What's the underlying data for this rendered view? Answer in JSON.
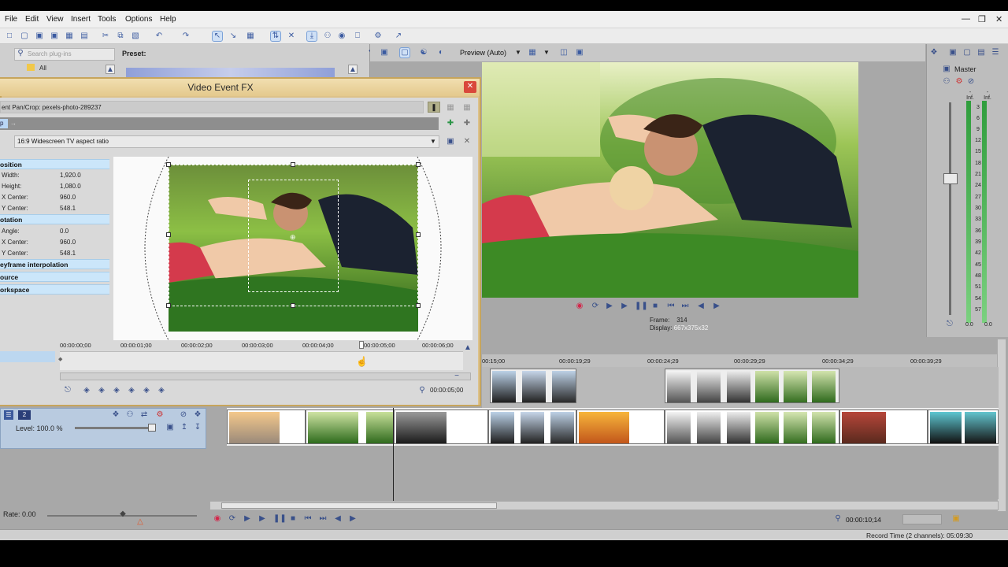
{
  "menu": [
    "File",
    "Edit",
    "View",
    "Insert",
    "Tools",
    "Options",
    "Help"
  ],
  "plugin_chooser": {
    "search_placeholder": "Search plug-ins",
    "preset_label": "Preset:",
    "tree_root": "All"
  },
  "preview": {
    "mode_label": "Preview (Auto)",
    "frame_label": "Frame:",
    "frame_value": "314",
    "display_label": "Display:",
    "display_value": "667x375x32"
  },
  "master": {
    "title": "Master",
    "meter_scale": [
      "-Inf.",
      "-Inf.",
      "3",
      "6",
      "9",
      "12",
      "15",
      "18",
      "21",
      "24",
      "27",
      "30",
      "33",
      "36",
      "39",
      "42",
      "45",
      "48",
      "51",
      "54",
      "57"
    ],
    "footer_left": "0.0",
    "footer_right": "0.0"
  },
  "fx_window": {
    "title": "Video Event FX",
    "plugin_chain": "ent Pan/Crop:  pexels-photo-289237",
    "aspect_option": "16:9 Widescreen TV aspect ratio",
    "chip": "p"
  },
  "properties": {
    "position_header": "osition",
    "width_label": "Width:",
    "width_value": "1,920.0",
    "height_label": "Height:",
    "height_value": "1,080.0",
    "xc_label": "X Center:",
    "xc_value": "960.0",
    "yc_label": "Y Center:",
    "yc_value": "548.1",
    "rotation_header": "otation",
    "angle_label": "Angle:",
    "angle_value": "0.0",
    "rxc_label": "X Center:",
    "rxc_value": "960.0",
    "ryc_label": "Y Center:",
    "ryc_value": "548.1",
    "kf_interp_header": "eyframe interpolation",
    "source_header": "ource",
    "workspace_header": "orkspace"
  },
  "keyframe_timeline": {
    "ticks": [
      "00:00:00;00",
      "00:00:01;00",
      "00:00:02;00",
      "00:00:03;00",
      "00:00:04;00",
      "00:00:05;00",
      "00:00:06;00"
    ],
    "end_time": "00:00:05;00"
  },
  "timeline": {
    "ticks": [
      "00:15;00",
      "00:00:19;29",
      "00:00:24;29",
      "00:00:29;29",
      "00:00:34;29",
      "00:00:39;29"
    ],
    "level_label": "Level: 100.0 %",
    "track_number": "2",
    "rate_label": "Rate: 0.00",
    "time_display": "00:00:10;14",
    "record_time": "Record Time (2 channels): 05:09:30"
  }
}
